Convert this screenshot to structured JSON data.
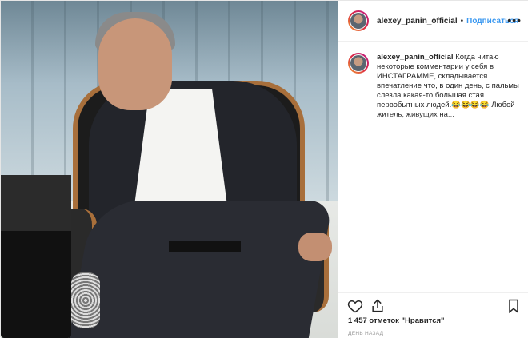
{
  "post": {
    "username": "alexey_panin_official",
    "follow_label": "Подписаться",
    "separator": "•",
    "more_icon": "more-horizontal-icon",
    "caption_text": "Когда читаю некоторые комментарии у себя в ИНСТАГРАММЕ, складывается впечатление что, в один день, с пальмы слезла какая-то большая стая первобытных людей.😂😂😂😂 Любой житель, живущих на...",
    "likes_count": "1 457",
    "likes_text": "отметок \"Нравится\"",
    "time_ago": "день назад",
    "icons": {
      "like": "heart-icon",
      "share": "share-upload-icon",
      "save": "bookmark-icon"
    },
    "colors": {
      "follow": "#3897f0",
      "text": "#262626",
      "muted": "#999999"
    }
  }
}
